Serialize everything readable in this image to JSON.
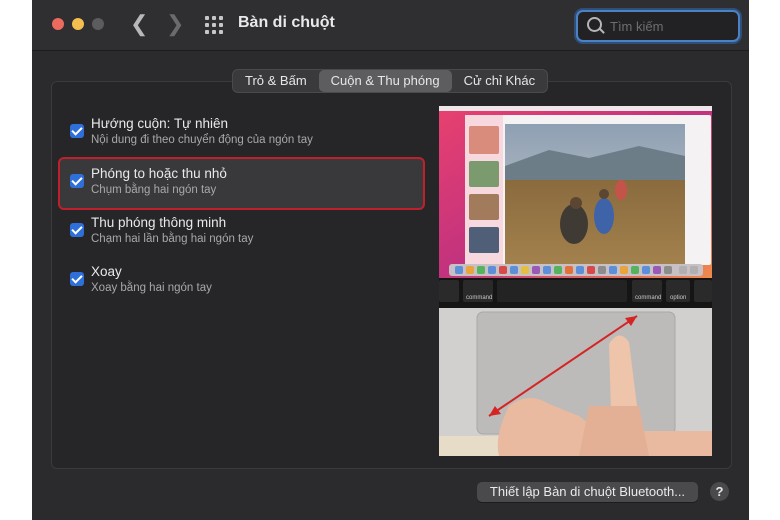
{
  "window": {
    "title": "Bàn di chuột"
  },
  "search": {
    "placeholder": "Tìm kiếm"
  },
  "tabs": [
    {
      "label": "Trỏ & Bấm",
      "active": false
    },
    {
      "label": "Cuộn & Thu phóng",
      "active": true
    },
    {
      "label": "Cử chỉ Khác",
      "active": false
    }
  ],
  "options": [
    {
      "title": "Hướng cuộn: Tự nhiên",
      "subtitle": "Nội dung đi theo chuyển động của ngón tay",
      "checked": true
    },
    {
      "title": "Phóng to hoặc thu nhỏ",
      "subtitle": "Chụm bằng hai ngón tay",
      "checked": true,
      "highlighted": true
    },
    {
      "title": "Thu phóng thông minh",
      "subtitle": "Chạm hai lần bằng hai ngón tay",
      "checked": true
    },
    {
      "title": "Xoay",
      "subtitle": "Xoay bằng hai ngón tay",
      "checked": true
    }
  ],
  "preview": {
    "touchbar_keys": [
      "command",
      "command",
      "option"
    ]
  },
  "footer": {
    "bluetooth_button": "Thiết lập Bàn di chuột Bluetooth...",
    "help_label": "?"
  },
  "colors": {
    "accent": "#2f6fda",
    "highlight_border": "#c0202b"
  }
}
